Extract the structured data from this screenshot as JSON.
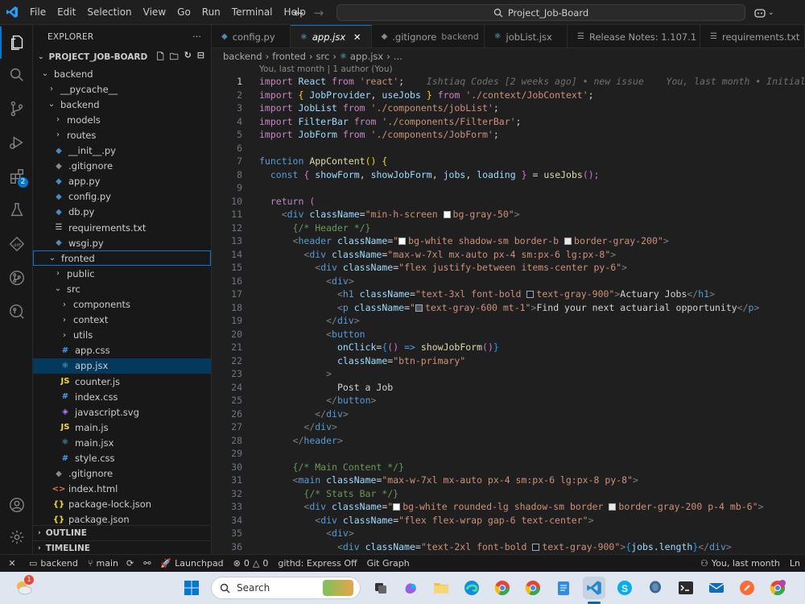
{
  "menu": [
    "File",
    "Edit",
    "Selection",
    "View",
    "Go",
    "Run",
    "Terminal",
    "Help"
  ],
  "command_center": "Project_Job-Board",
  "sidebar": {
    "header": "EXPLORER",
    "project": "PROJECT_JOB-BOARD",
    "tree": [
      {
        "label": "backend",
        "kind": "folder-open",
        "depth": 0
      },
      {
        "label": "__pycache__",
        "kind": "folder",
        "depth": 1
      },
      {
        "label": "backend",
        "kind": "folder-open",
        "depth": 1
      },
      {
        "label": "models",
        "kind": "folder",
        "depth": 2
      },
      {
        "label": "routes",
        "kind": "folder",
        "depth": 2
      },
      {
        "label": "__init__.py",
        "kind": "py",
        "depth": 2
      },
      {
        "label": ".gitignore",
        "kind": "git",
        "depth": 2
      },
      {
        "label": "app.py",
        "kind": "py",
        "depth": 2
      },
      {
        "label": "config.py",
        "kind": "py",
        "depth": 2
      },
      {
        "label": "db.py",
        "kind": "py",
        "depth": 2
      },
      {
        "label": "requirements.txt",
        "kind": "txt",
        "depth": 2
      },
      {
        "label": "wsgi.py",
        "kind": "py",
        "depth": 2
      },
      {
        "label": "fronted",
        "kind": "folder-open",
        "depth": 1
      },
      {
        "label": "public",
        "kind": "folder",
        "depth": 2
      },
      {
        "label": "src",
        "kind": "folder-open",
        "depth": 2
      },
      {
        "label": "components",
        "kind": "folder",
        "depth": 3
      },
      {
        "label": "context",
        "kind": "folder",
        "depth": 3
      },
      {
        "label": "utils",
        "kind": "folder",
        "depth": 3
      },
      {
        "label": "app.css",
        "kind": "css",
        "depth": 3
      },
      {
        "label": "app.jsx",
        "kind": "jsx",
        "depth": 3
      },
      {
        "label": "counter.js",
        "kind": "js",
        "depth": 3
      },
      {
        "label": "index.css",
        "kind": "css",
        "depth": 3
      },
      {
        "label": "javascript.svg",
        "kind": "svg",
        "depth": 3
      },
      {
        "label": "main.js",
        "kind": "js",
        "depth": 3
      },
      {
        "label": "main.jsx",
        "kind": "jsx",
        "depth": 3
      },
      {
        "label": "style.css",
        "kind": "css",
        "depth": 3
      },
      {
        "label": ".gitignore",
        "kind": "git",
        "depth": 2
      },
      {
        "label": "index.html",
        "kind": "html",
        "depth": 2
      },
      {
        "label": "package-lock.json",
        "kind": "json",
        "depth": 2
      },
      {
        "label": "package.json",
        "kind": "json",
        "depth": 2
      }
    ],
    "outline": "OUTLINE",
    "timeline": "TIMELINE"
  },
  "tabs": [
    {
      "label": "config.py",
      "icon": "py"
    },
    {
      "label": "app.jsx",
      "icon": "jsx",
      "active": true
    },
    {
      "label": ".gitignore",
      "desc": "backend",
      "icon": "git"
    },
    {
      "label": "jobList.jsx",
      "icon": "jsx"
    },
    {
      "label": "Release Notes: 1.107.1",
      "icon": "notes"
    },
    {
      "label": "requirements.txt",
      "icon": "txt"
    }
  ],
  "breadcrumb": [
    "backend",
    "fronted",
    "src",
    "app.jsx",
    "..."
  ],
  "blame_header": "You, last month | 1 author (You)",
  "line_numbers": [
    1,
    2,
    3,
    4,
    5,
    6,
    7,
    8,
    9,
    10,
    11,
    12,
    13,
    14,
    15,
    16,
    17,
    18,
    19,
    20,
    21,
    22,
    23,
    24,
    25,
    26,
    27,
    28,
    29,
    30,
    31,
    32,
    33,
    34,
    35,
    36
  ],
  "code": {
    "l1": [
      "import",
      "React",
      "from",
      "'react'",
      ";"
    ],
    "l1_ghost": "Ishtiaq Codes [2 weeks ago] • new issue",
    "l1_blame": "You, last month • Initial",
    "l2": [
      "import",
      "{",
      "JobProvider",
      ",",
      "useJobs",
      "}",
      "from",
      "'./context/JobContext'",
      ";"
    ],
    "l3": [
      "import",
      "JobList",
      "from",
      "'./components/jobList'",
      ";"
    ],
    "l4": [
      "import",
      "FilterBar",
      "from",
      "'./components/FilterBar'",
      ";"
    ],
    "l5": [
      "import",
      "JobForm",
      "from",
      "'./components/JobForm'",
      ";"
    ],
    "l7": [
      "function",
      "AppContent",
      "()",
      "{"
    ],
    "l8": [
      "const",
      "{",
      "showForm",
      ",",
      "showJobForm",
      ",",
      "jobs",
      ",",
      "loading",
      "}",
      "=",
      "useJobs",
      "();"
    ],
    "l10": [
      "return",
      "("
    ],
    "l11": [
      "<",
      "div",
      "className",
      "=",
      "\"min-h-screen ",
      "bg-gray-50\"",
      ">"
    ],
    "l12": [
      "{/* Header */}"
    ],
    "l13": [
      "<",
      "header",
      "className",
      "=",
      "\"",
      "bg-white shadow-sm border-b ",
      "border-gray-200\"",
      ">"
    ],
    "l14": [
      "<",
      "div",
      "className",
      "=",
      "\"max-w-7xl mx-auto px-4 sm:px-6 lg:px-8\"",
      ">"
    ],
    "l15": [
      "<",
      "div",
      "className",
      "=",
      "\"flex justify-between items-center py-6\"",
      ">"
    ],
    "l16": [
      "<",
      "div",
      ">"
    ],
    "l17": [
      "<",
      "h1",
      "className",
      "=",
      "\"text-3xl font-bold ",
      "text-gray-900\"",
      ">",
      "Actuary Jobs",
      "</",
      "h1",
      ">"
    ],
    "l18": [
      "<",
      "p",
      "className",
      "=",
      "\"",
      "text-gray-600 mt-1\"",
      ">",
      "Find your next actuarial opportunity",
      "</",
      "p",
      ">"
    ],
    "l19": [
      "</",
      "div",
      ">"
    ],
    "l20": [
      "<",
      "button"
    ],
    "l21": [
      "onClick",
      "=",
      "{",
      "()",
      "=>",
      "showJobForm",
      "()",
      "}"
    ],
    "l22": [
      "className",
      "=",
      "\"btn-primary\""
    ],
    "l23": [
      ">"
    ],
    "l24": [
      "Post a Job"
    ],
    "l25": [
      "</",
      "button",
      ">"
    ],
    "l26": [
      "</",
      "div",
      ">"
    ],
    "l27": [
      "</",
      "div",
      ">"
    ],
    "l28": [
      "</",
      "header",
      ">"
    ],
    "l30": [
      "{/* Main Content */}"
    ],
    "l31": [
      "<",
      "main",
      "className",
      "=",
      "\"max-w-7xl mx-auto px-4 sm:px-6 lg:px-8 py-8\"",
      ">"
    ],
    "l32": [
      "{/* Stats Bar */}"
    ],
    "l33": [
      "<",
      "div",
      "className",
      "=",
      "\"",
      "bg-white rounded-lg shadow-sm border ",
      "border-gray-200 p-4 mb-6\"",
      ">"
    ],
    "l34": [
      "<",
      "div",
      "className",
      "=",
      "\"flex flex-wrap gap-6 text-center\"",
      ">"
    ],
    "l35": [
      "<",
      "div",
      ">"
    ],
    "l36": [
      "<",
      "div",
      "className",
      "=",
      "\"text-2xl font-bold ",
      "text-gray-900\"",
      ">",
      "{",
      "jobs.length",
      "}",
      "</",
      "div",
      ">"
    ]
  },
  "statusbar": {
    "folder": "backend",
    "branch": "main",
    "launchpad": "Launchpad",
    "errors": "0",
    "warnings": "0",
    "githd": "githd: Express Off",
    "gitgraph": "Git Graph",
    "blame": "You, last month",
    "cursor": "Ln"
  },
  "taskbar": {
    "search_placeholder": "Search",
    "weather_badge": "1"
  },
  "colors": {
    "accent": "#0078d4",
    "editor_bg": "#1f1f1f",
    "sidebar_bg": "#181818",
    "selection": "#04395e"
  }
}
